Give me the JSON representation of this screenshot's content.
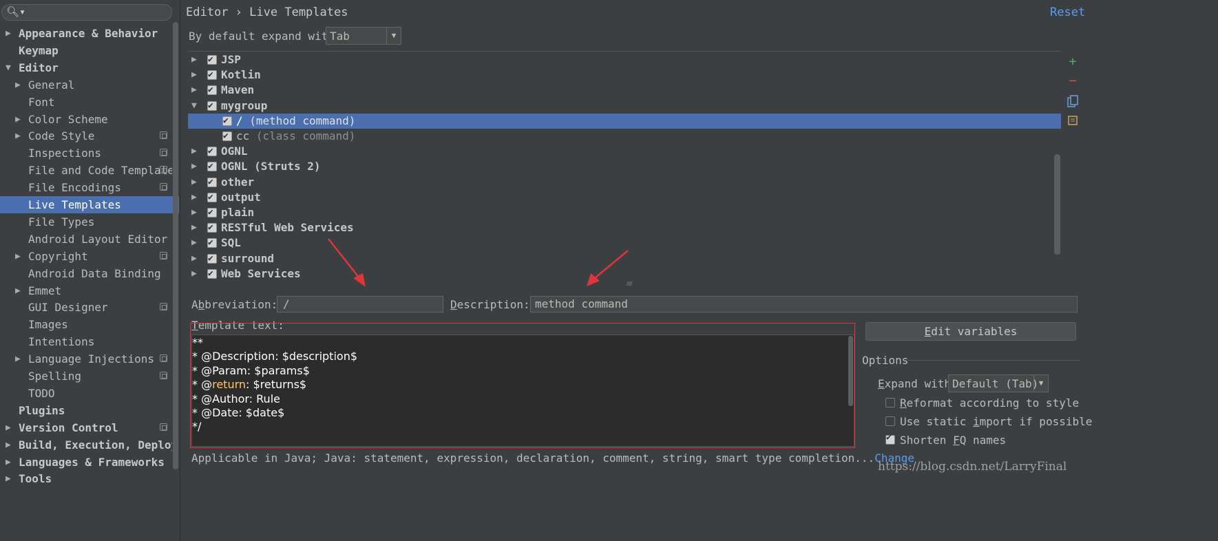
{
  "sidebar": {
    "search_icon": "search-icon",
    "items": [
      {
        "label": "Appearance & Behavior",
        "level": 0,
        "arrow": "right",
        "bold": true
      },
      {
        "label": "Keymap",
        "level": 0,
        "arrow": "",
        "bold": true
      },
      {
        "label": "Editor",
        "level": 0,
        "arrow": "down",
        "bold": true
      },
      {
        "label": "General",
        "level": 1,
        "arrow": "right"
      },
      {
        "label": "Font",
        "level": 1,
        "arrow": ""
      },
      {
        "label": "Color Scheme",
        "level": 1,
        "arrow": "right"
      },
      {
        "label": "Code Style",
        "level": 1,
        "arrow": "right",
        "project": true
      },
      {
        "label": "Inspections",
        "level": 1,
        "arrow": "",
        "project": true
      },
      {
        "label": "File and Code Templates",
        "level": 1,
        "arrow": "",
        "project": true
      },
      {
        "label": "File Encodings",
        "level": 1,
        "arrow": "",
        "project": true
      },
      {
        "label": "Live Templates",
        "level": 1,
        "arrow": "",
        "selected": true
      },
      {
        "label": "File Types",
        "level": 1,
        "arrow": ""
      },
      {
        "label": "Android Layout Editor",
        "level": 1,
        "arrow": ""
      },
      {
        "label": "Copyright",
        "level": 1,
        "arrow": "right",
        "project": true
      },
      {
        "label": "Android Data Binding",
        "level": 1,
        "arrow": ""
      },
      {
        "label": "Emmet",
        "level": 1,
        "arrow": "right"
      },
      {
        "label": "GUI Designer",
        "level": 1,
        "arrow": "",
        "project": true
      },
      {
        "label": "Images",
        "level": 1,
        "arrow": ""
      },
      {
        "label": "Intentions",
        "level": 1,
        "arrow": ""
      },
      {
        "label": "Language Injections",
        "level": 1,
        "arrow": "right",
        "project": true
      },
      {
        "label": "Spelling",
        "level": 1,
        "arrow": "",
        "project": true
      },
      {
        "label": "TODO",
        "level": 1,
        "arrow": ""
      },
      {
        "label": "Plugins",
        "level": 0,
        "arrow": "",
        "bold": true
      },
      {
        "label": "Version Control",
        "level": 0,
        "arrow": "right",
        "bold": true,
        "project": true
      },
      {
        "label": "Build, Execution, Deployment",
        "level": 0,
        "arrow": "right",
        "bold": true
      },
      {
        "label": "Languages & Frameworks",
        "level": 0,
        "arrow": "right",
        "bold": true
      },
      {
        "label": "Tools",
        "level": 0,
        "arrow": "right",
        "bold": true
      }
    ]
  },
  "header": {
    "breadcrumb_parent": "Editor",
    "breadcrumb_sep": "›",
    "breadcrumb_current": "Live Templates",
    "reset_label": "Reset"
  },
  "expand": {
    "label": "By default expand with",
    "value": "Tab"
  },
  "templates": [
    {
      "name": "JSP",
      "type": "group",
      "expanded": false
    },
    {
      "name": "Kotlin",
      "type": "group",
      "expanded": false
    },
    {
      "name": "Maven",
      "type": "group",
      "expanded": false
    },
    {
      "name": "mygroup",
      "type": "group",
      "expanded": true
    },
    {
      "name": "/",
      "desc": " (method command)",
      "type": "item",
      "selected": true
    },
    {
      "name": "cc",
      "desc": " (class command)",
      "type": "item"
    },
    {
      "name": "OGNL",
      "type": "group",
      "expanded": false
    },
    {
      "name": "OGNL (Struts 2)",
      "type": "group",
      "expanded": false
    },
    {
      "name": "other",
      "type": "group",
      "expanded": false
    },
    {
      "name": "output",
      "type": "group",
      "expanded": false
    },
    {
      "name": "plain",
      "type": "group",
      "expanded": false
    },
    {
      "name": "RESTful Web Services",
      "type": "group",
      "expanded": false
    },
    {
      "name": "SQL",
      "type": "group",
      "expanded": false
    },
    {
      "name": "surround",
      "type": "group",
      "expanded": false
    },
    {
      "name": "Web Services",
      "type": "group",
      "expanded": false
    }
  ],
  "tools": {
    "add": "+",
    "remove": "−",
    "add_icon": "add-icon",
    "remove_icon": "remove-icon",
    "copy_icon": "copy-icon",
    "edit_icon": "edit-icon"
  },
  "abbreviation": {
    "label_pre": "A",
    "label_mn": "b",
    "label_post": "breviation:",
    "value": "/"
  },
  "description": {
    "label_mn": "D",
    "label_post": "escription:",
    "value": "method command"
  },
  "template_text": {
    "label_mn": "T",
    "label_post": "emplate text:",
    "lines": {
      "l1": "**",
      "l2": "* @Description: $description$",
      "l3a": "* @",
      "l3b": "Param",
      "l3c": ": $params$",
      "l4a": "* @",
      "l4b": "return",
      "l4c": ": $returns$",
      "l5": "* @Author: Rule",
      "l6": "* @Date: $date$",
      "l7": "*/"
    }
  },
  "applicable": {
    "text": "Applicable in Java; Java: statement, expression, declaration, comment, string, smart type completion...",
    "link": "Change"
  },
  "options": {
    "edit_variables_mn": "E",
    "edit_variables_post": "dit variables",
    "title": "Options",
    "expand_label_mn": "E",
    "expand_label_post": "xpand with",
    "expand_value": "Default (Tab)",
    "reformat_mn": "R",
    "reformat_post": "eformat according to style",
    "reformat_checked": false,
    "static_pre": "Use static ",
    "static_mn": "i",
    "static_post": "mport if possible",
    "static_checked": false,
    "shorten_pre": "Shorten ",
    "shorten_mn": "F",
    "shorten_post": "Q names",
    "shorten_checked": true
  },
  "watermark": "https://blog.csdn.net/LarryFinal",
  "colors": {
    "accent": "#4b6eaf",
    "link": "#589df6",
    "annotation": "#e0353a"
  }
}
